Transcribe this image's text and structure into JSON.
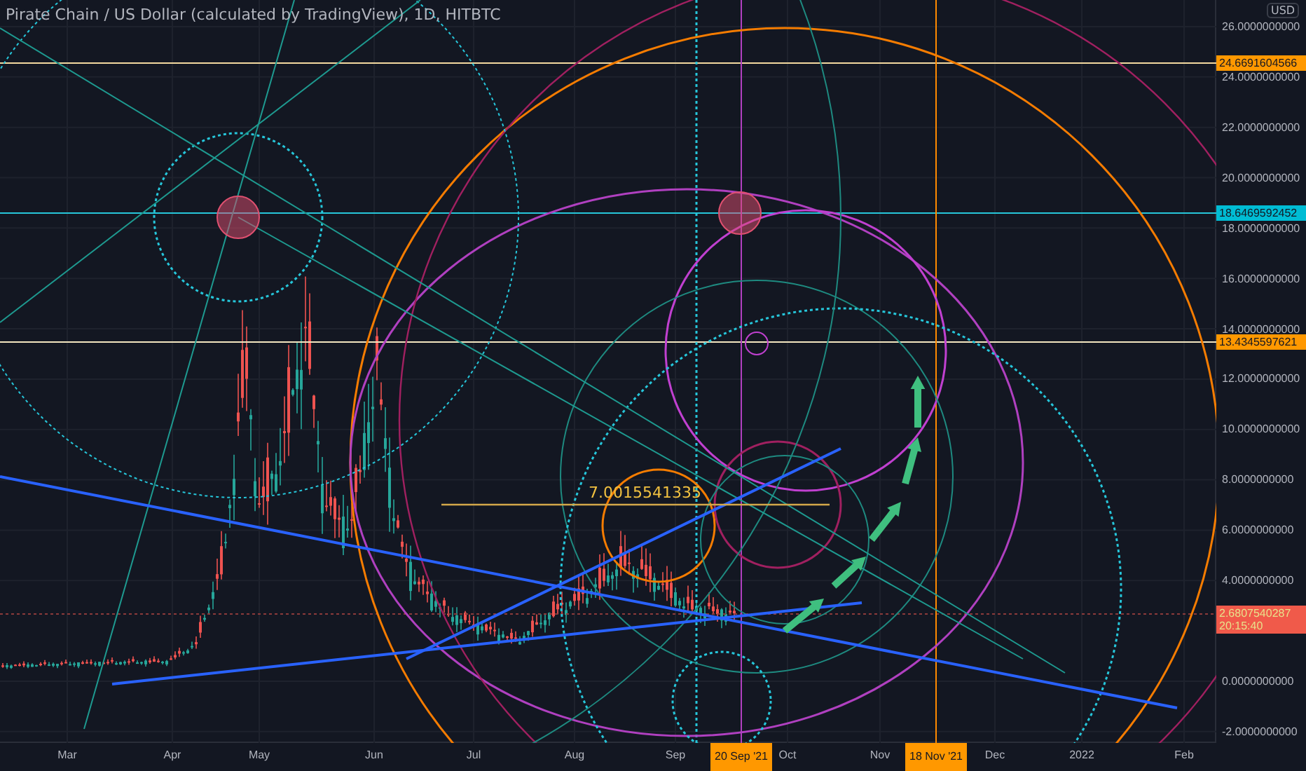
{
  "header": {
    "title": "Pirate Chain / US Dollar (calculated by TradingView), 1D, HITBTC"
  },
  "price_axis": {
    "unit": "USD",
    "ticks": [
      "26.0000000000",
      "24.0000000000",
      "22.0000000000",
      "20.0000000000",
      "18.0000000000",
      "16.0000000000",
      "14.0000000000",
      "12.0000000000",
      "10.0000000000",
      "8.0000000000",
      "6.0000000000",
      "4.0000000000",
      "0.0000000000",
      "-2.0000000000"
    ]
  },
  "price_markers": [
    {
      "label": "24.6691604566",
      "color": "#ff9800"
    },
    {
      "label": "18.6469592452",
      "color": "#00bcd4"
    },
    {
      "label": "13.4345597621",
      "color": "#ff9800"
    }
  ],
  "last_price": {
    "price": "2.6807540287",
    "countdown": "20:15:40"
  },
  "measure": {
    "label": "7.0015541335"
  },
  "time_axis": {
    "ticks": [
      "Mar",
      "Apr",
      "May",
      "Jun",
      "Jul",
      "Aug",
      "Sep",
      "Oct",
      "Nov",
      "Dec",
      "2022",
      "Feb"
    ]
  },
  "time_markers": [
    {
      "label": "20 Sep '21"
    },
    {
      "label": "18 Nov '21"
    }
  ]
}
